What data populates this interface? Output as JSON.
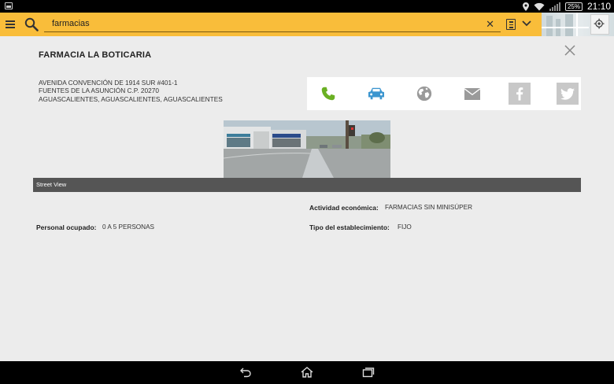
{
  "status_bar": {
    "time": "21:10",
    "battery": "25%"
  },
  "search": {
    "value": "farmacias"
  },
  "detail": {
    "title": "FARMACIA LA BOTICARIA",
    "address_lines": [
      "AVENIDA CONVENCIÓN DE 1914 SUR #401-1",
      "FUENTES DE LA ASUNCIÓN C.P. 20270",
      "AGUASCALIENTES, AGUASCALIENTES, AGUASCALIENTES"
    ],
    "streetview_label": "Street View",
    "actividad_label": "Actividad económica:",
    "actividad_value": "FARMACIAS SIN MINISÚPER",
    "personal_label": "Personal ocupado:",
    "personal_value": "0 A 5 PERSONAS",
    "tipo_label": "Tipo del establecimiento:",
    "tipo_value": "FIJO"
  },
  "icons": {
    "phone": "phone-icon",
    "car": "car-icon",
    "web": "globe-icon",
    "mail": "mail-icon",
    "facebook": "facebook-icon",
    "twitter": "twitter-icon"
  },
  "colors": {
    "toolbar": "#f9bd3a",
    "phone": "#6ab023",
    "car": "#3b95cf",
    "icon_gray": "#9a9a9a"
  }
}
